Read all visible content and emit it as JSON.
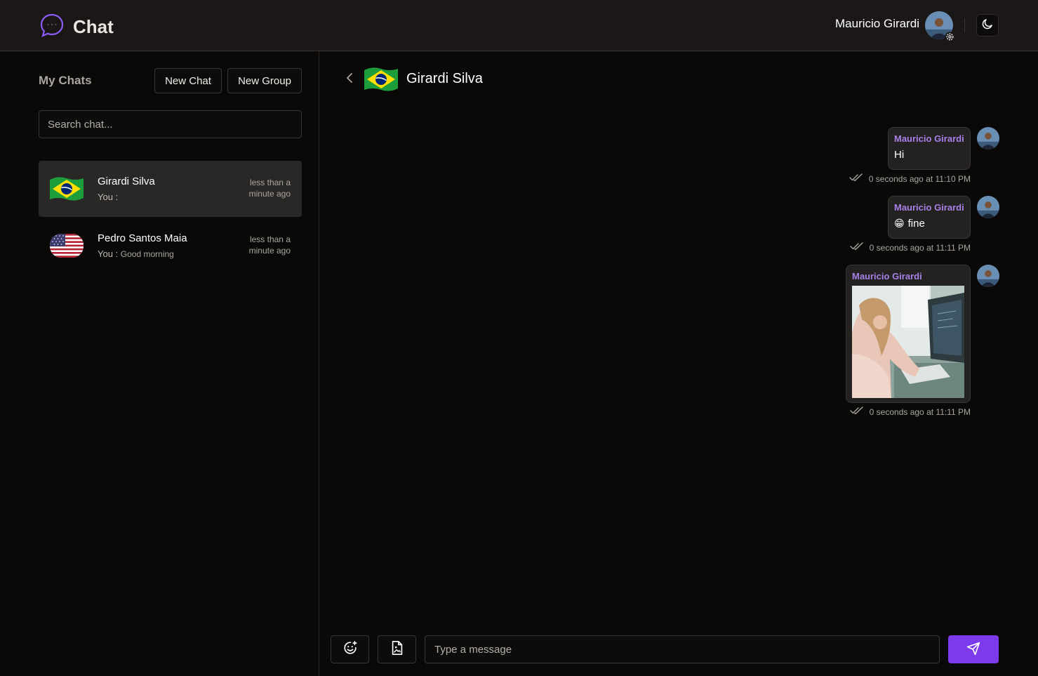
{
  "header": {
    "app_title": "Chat",
    "logo_icon": "chat-bubble-icon",
    "user_name": "Mauricio Girardi",
    "theme_icon": "moon-icon",
    "accent": "#7c3aed"
  },
  "sidebar": {
    "title": "My Chats",
    "new_chat_label": "New Chat",
    "new_group_label": "New Group",
    "search_placeholder": "Search chat...",
    "chats": [
      {
        "name": "Girardi Silva",
        "you": "You :",
        "last_message": "",
        "time": "less than a minute ago",
        "flag": "brazil"
      },
      {
        "name": "Pedro Santos Maia",
        "you": "You :",
        "last_message": "Good morning",
        "time": "less than a minute ago",
        "flag": "usa"
      }
    ]
  },
  "conversation": {
    "contact_name": "Girardi Silva",
    "messages": [
      {
        "author": "Mauricio Girardi",
        "text": "Hi",
        "emoji": "",
        "meta": "0 seconds ago at 11:10 PM"
      },
      {
        "author": "Mauricio Girardi",
        "text": "fine",
        "emoji": "😁",
        "meta": "0 seconds ago at 11:11 PM"
      },
      {
        "author": "Mauricio Girardi",
        "text": "",
        "image": "woman-working-at-computer",
        "meta": "0 seconds ago at 11:11 PM"
      }
    ],
    "composer": {
      "placeholder": "Type a message",
      "emoji_icon": "emoji-add-icon",
      "attach_icon": "file-image-icon",
      "send_icon": "send-icon"
    }
  }
}
